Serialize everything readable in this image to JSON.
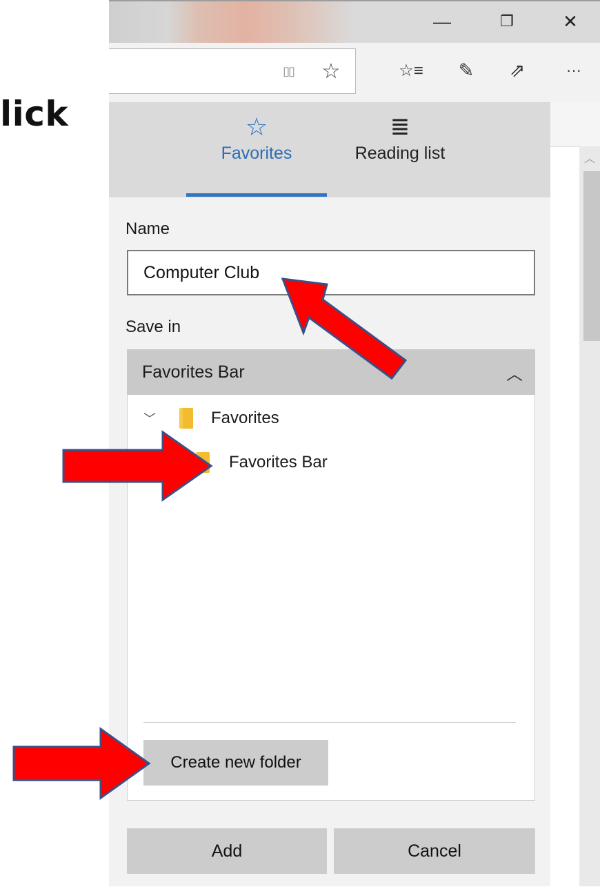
{
  "caption": "lick",
  "window_controls": {
    "minimize_icon": "—",
    "restore_icon": "❐",
    "close_icon": "✕"
  },
  "toolbar": {
    "reading_view_icon": "▯▯",
    "add_favorite_icon": "☆",
    "hub_icon": "☆≡",
    "notes_icon": "✎",
    "share_icon": "⇗",
    "more_icon": "···"
  },
  "panel": {
    "tabs": [
      {
        "label": "Favorites",
        "icon": "☆",
        "active": true
      },
      {
        "label": "Reading list",
        "icon": "≣",
        "active": false
      }
    ],
    "name_label": "Name",
    "name_value": "Computer Club",
    "save_in_label": "Save in",
    "save_in_selected": "Favorites Bar",
    "collapse_icon": "︿",
    "tree": [
      {
        "label": "Favorites",
        "expander": "﹀",
        "level": 0
      },
      {
        "label": "Favorites Bar",
        "level": 1
      }
    ],
    "create_folder_label": "Create new folder",
    "add_label": "Add",
    "cancel_label": "Cancel"
  },
  "colors": {
    "accent": "#2f75c4",
    "annotation_arrow_fill": "#ff0000",
    "annotation_arrow_stroke": "#3b4f86",
    "folder": "#f7c948"
  }
}
